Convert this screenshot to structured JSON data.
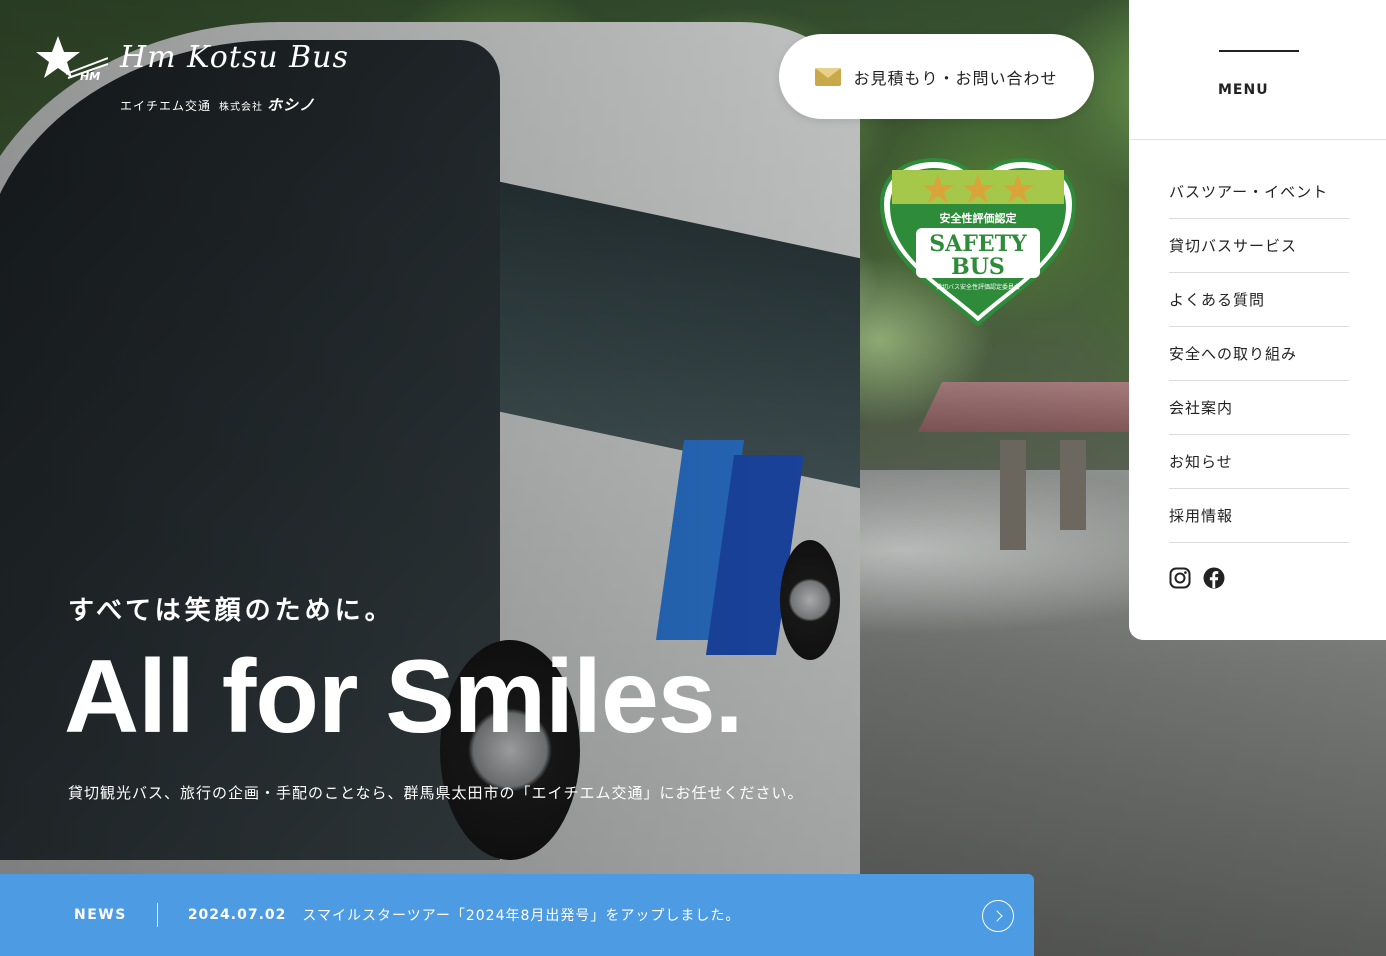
{
  "logo": {
    "name": "Hm Kotsu Bus",
    "mark": "HM",
    "subtitle": "エイチエム交通",
    "corp": "株式会社",
    "company": "ホシノ"
  },
  "header": {
    "contact_label": "お見積もり・お問い合わせ",
    "contact_icon": "mail-icon"
  },
  "badge": {
    "top_text": "安全性評価認定",
    "main_line1": "SAFETY",
    "main_line2": "BUS",
    "footer": "貸切バス安全性評価認定委員会",
    "stars": 3
  },
  "menu": {
    "label": "MENU",
    "items": [
      {
        "label": "バスツアー・イベント"
      },
      {
        "label": "貸切バスサービス"
      },
      {
        "label": "よくある質問"
      },
      {
        "label": "安全への取り組み"
      },
      {
        "label": "会社案内"
      },
      {
        "label": "お知らせ"
      },
      {
        "label": "採用情報"
      }
    ],
    "social": [
      "instagram-icon",
      "facebook-icon"
    ]
  },
  "hero": {
    "tagline": "すべては笑顔のために。",
    "headline": "All for Smiles.",
    "description": "貸切観光バス、旅行の企画・手配のことなら、群馬県太田市の「エイチエム交通」にお任せください。"
  },
  "news": {
    "label": "NEWS",
    "date": "2024.07.02",
    "text": "スマイルスターツアー「2024年8月出発号」をアップしました。"
  },
  "colors": {
    "news_bar": "#4d9be3",
    "badge_green": "#2e8b3a",
    "badge_gold": "#d9a43a"
  }
}
